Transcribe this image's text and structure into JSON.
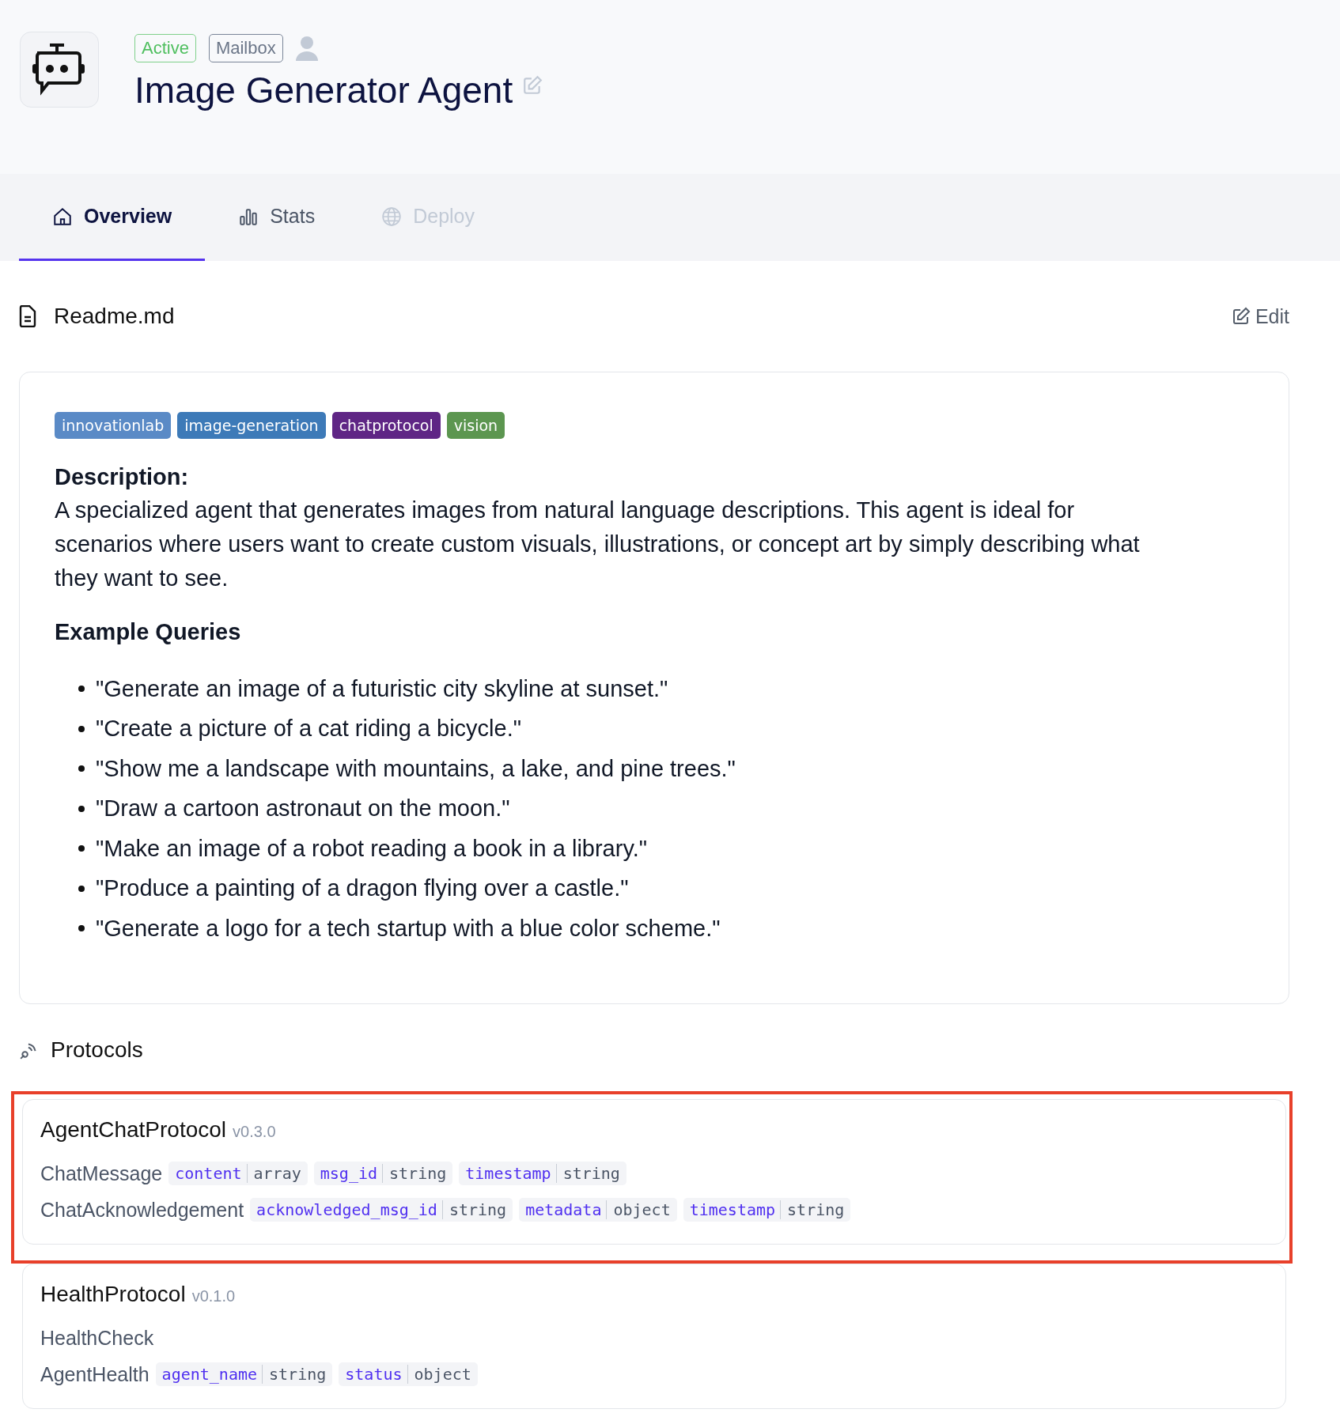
{
  "agent": {
    "badges": [
      {
        "label": "Active",
        "kind": "active"
      },
      {
        "label": "Mailbox",
        "kind": "neutral"
      }
    ],
    "title": "Image Generator Agent"
  },
  "tabs": [
    {
      "label": "Overview",
      "kind": "home",
      "selected": true,
      "disabled": false
    },
    {
      "label": "Stats",
      "kind": "chart",
      "selected": false,
      "disabled": false
    },
    {
      "label": "Deploy",
      "kind": "globe",
      "selected": false,
      "disabled": true
    }
  ],
  "readme": {
    "title": "Readme.md",
    "edit_label": "Edit",
    "tags": [
      {
        "label": "innovationlab",
        "color": "#5a8ac6"
      },
      {
        "label": "image-generation",
        "color": "#3d7ab8"
      },
      {
        "label": "chatprotocol",
        "color": "#5f2685"
      },
      {
        "label": "vision",
        "color": "#5c9650"
      }
    ],
    "description_heading": "Description:",
    "description": "A specialized agent that generates images from natural language descriptions. This agent is ideal for scenarios where users want to create custom visuals, illustrations, or concept art by simply describing what they want to see.",
    "examples_heading": "Example Queries",
    "examples": [
      "\"Generate an image of a futuristic city skyline at sunset.\"",
      "\"Create a picture of a cat riding a bicycle.\"",
      "\"Show me a landscape with mountains, a lake, and pine trees.\"",
      "\"Draw a cartoon astronaut on the moon.\"",
      "\"Make an image of a robot reading a book in a library.\"",
      "\"Produce a painting of a dragon flying over a castle.\"",
      "\"Generate a logo for a tech startup with a blue color scheme.\""
    ]
  },
  "protocols": {
    "title": "Protocols",
    "items": [
      {
        "name": "AgentChatProtocol",
        "version": "v0.3.0",
        "highlighted": true,
        "messages": [
          {
            "name": "ChatMessage",
            "fields": [
              {
                "name": "content",
                "type": "array"
              },
              {
                "name": "msg_id",
                "type": "string"
              },
              {
                "name": "timestamp",
                "type": "string"
              }
            ]
          },
          {
            "name": "ChatAcknowledgement",
            "fields": [
              {
                "name": "acknowledged_msg_id",
                "type": "string"
              },
              {
                "name": "metadata",
                "type": "object"
              },
              {
                "name": "timestamp",
                "type": "string"
              }
            ]
          }
        ]
      },
      {
        "name": "HealthProtocol",
        "version": "v0.1.0",
        "highlighted": false,
        "messages": [
          {
            "name": "HealthCheck"
          },
          {
            "name": "AgentHealth",
            "fields": [
              {
                "name": "agent_name",
                "type": "string"
              },
              {
                "name": "status",
                "type": "object"
              }
            ]
          }
        ]
      }
    ]
  }
}
